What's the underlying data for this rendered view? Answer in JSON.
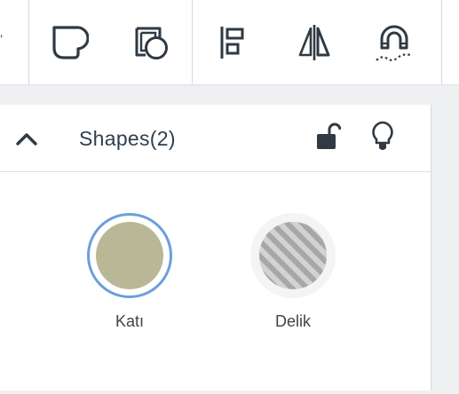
{
  "toolbar": {
    "left_fragment": "’",
    "buttons": [
      {
        "icon": "solid-shape-icon",
        "label": ""
      },
      {
        "icon": "hole-shape-icon",
        "label": ""
      },
      {
        "icon": "align-icon",
        "label": ""
      },
      {
        "icon": "mirror-icon",
        "label": ""
      },
      {
        "icon": "magnet-icon",
        "label": ""
      }
    ]
  },
  "panel": {
    "title": "Shapes(2)",
    "collapse_icon": "chevron-up-icon",
    "lock_icon": "unlock-icon",
    "bulb_icon": "lightbulb-icon",
    "items": [
      {
        "label": "Katı",
        "type": "solid",
        "color": "#b9b896",
        "selected": true
      },
      {
        "label": "Delik",
        "type": "hole",
        "color": "#a7a7a7",
        "selected": false
      }
    ]
  },
  "colors": {
    "selection_ring": "#6a9fdc",
    "title_text": "#2d3f4f",
    "icon_dark": "#2f3a44"
  }
}
